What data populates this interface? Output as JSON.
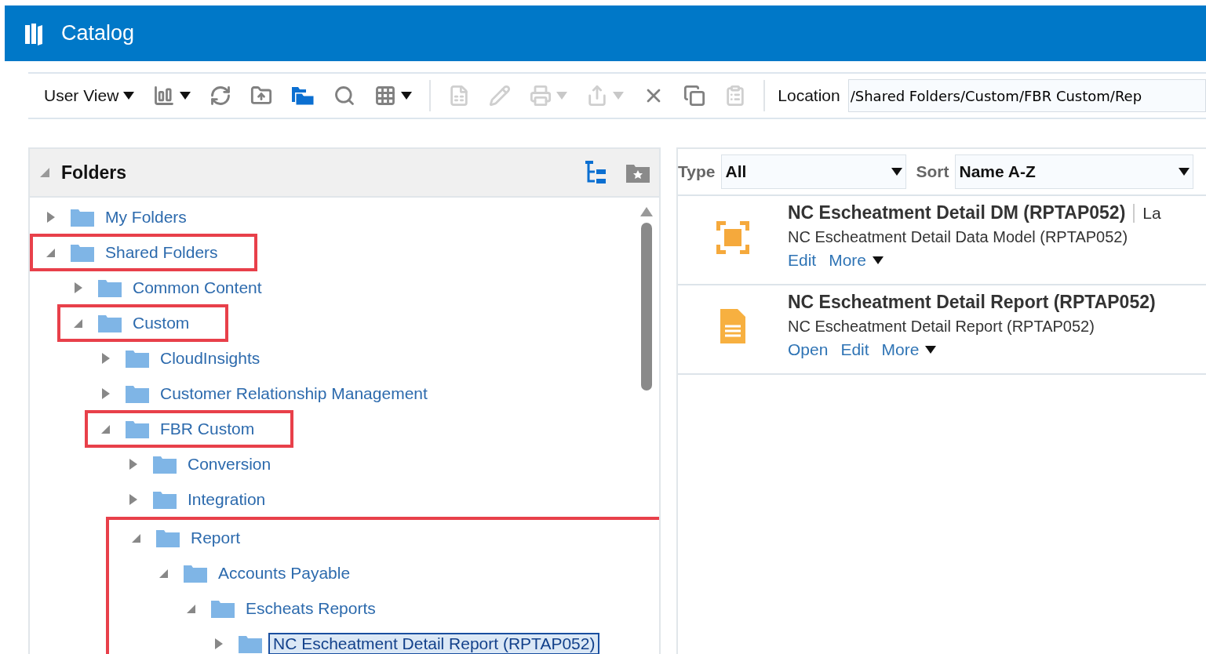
{
  "window": {
    "title": "Catalog"
  },
  "toolbar": {
    "items": [
      {
        "kind": "dropdown",
        "label": "User View",
        "disabled": false
      },
      {
        "kind": "icon",
        "caret": true,
        "disabled": false
      },
      {
        "kind": "icon",
        "caret": false,
        "disabled": false
      },
      {
        "kind": "icon",
        "caret": false,
        "disabled": false
      },
      {
        "kind": "icon",
        "caret": false,
        "disabled": false,
        "accent": true
      },
      {
        "kind": "icon",
        "caret": false,
        "disabled": false
      },
      {
        "kind": "icon",
        "caret": true,
        "disabled": false
      },
      {
        "kind": "separator"
      },
      {
        "kind": "icon",
        "caret": false,
        "disabled": true
      },
      {
        "kind": "icon",
        "caret": false,
        "disabled": true
      },
      {
        "kind": "icon",
        "caret": true,
        "disabled": true
      },
      {
        "kind": "icon",
        "caret": true,
        "disabled": true
      },
      {
        "kind": "icon",
        "caret": false,
        "disabled": false
      },
      {
        "kind": "icon",
        "caret": false,
        "disabled": false
      },
      {
        "kind": "icon",
        "caret": false,
        "disabled": true
      },
      {
        "kind": "separator"
      }
    ],
    "location": {
      "label": "Location",
      "value": "/Shared Folders/Custom/FBR Custom/Rep"
    }
  },
  "folders": {
    "title": "Folders",
    "expanded": true,
    "tree": [
      {
        "label": "My Folders",
        "expanded": false,
        "selected": false
      },
      {
        "label": "Shared Folders",
        "expanded": true,
        "selected": false,
        "highlighted": true,
        "children": [
          {
            "label": "Common Content",
            "expanded": false,
            "selected": false
          },
          {
            "label": "Custom",
            "expanded": true,
            "selected": false,
            "highlighted": true,
            "children": [
              {
                "label": "CloudInsights",
                "expanded": false,
                "selected": false
              },
              {
                "label": "Customer Relationship Management",
                "expanded": false,
                "selected": false
              },
              {
                "label": "FBR Custom",
                "expanded": true,
                "selected": false,
                "highlighted": true,
                "children": [
                  {
                    "label": "Conversion",
                    "expanded": false,
                    "selected": false
                  },
                  {
                    "label": "Integration",
                    "expanded": false,
                    "selected": false
                  },
                  {
                    "label": "Report",
                    "expanded": true,
                    "selected": false,
                    "highlighted": true,
                    "highlight_includes_children": true,
                    "children": [
                      {
                        "label": "Accounts Payable",
                        "expanded": true,
                        "selected": false,
                        "children": [
                          {
                            "label": "Escheats Reports",
                            "expanded": true,
                            "selected": false,
                            "children": [
                              {
                                "label": "NC Escheatment Detail Report (RPTAP052)",
                                "expanded": false,
                                "selected": true
                              }
                            ]
                          }
                        ]
                      }
                    ]
                  }
                ]
              }
            ]
          }
        ]
      }
    ]
  },
  "content": {
    "type_filter": {
      "label": "Type",
      "value": "All"
    },
    "sort": {
      "label": "Sort",
      "value": "Name A-Z"
    },
    "items": [
      {
        "kind": "data_model",
        "title": "NC Escheatment Detail DM (RPTAP052)",
        "meta": "La",
        "description": "NC Escheatment Detail Data Model (RPTAP052)",
        "actions": [
          "Edit"
        ],
        "more": "More"
      },
      {
        "kind": "report",
        "title": "NC Escheatment Detail Report (RPTAP052)",
        "description": "NC Escheatment Detail Report (RPTAP052)",
        "actions": [
          "Open",
          "Edit"
        ],
        "more": "More"
      }
    ]
  }
}
